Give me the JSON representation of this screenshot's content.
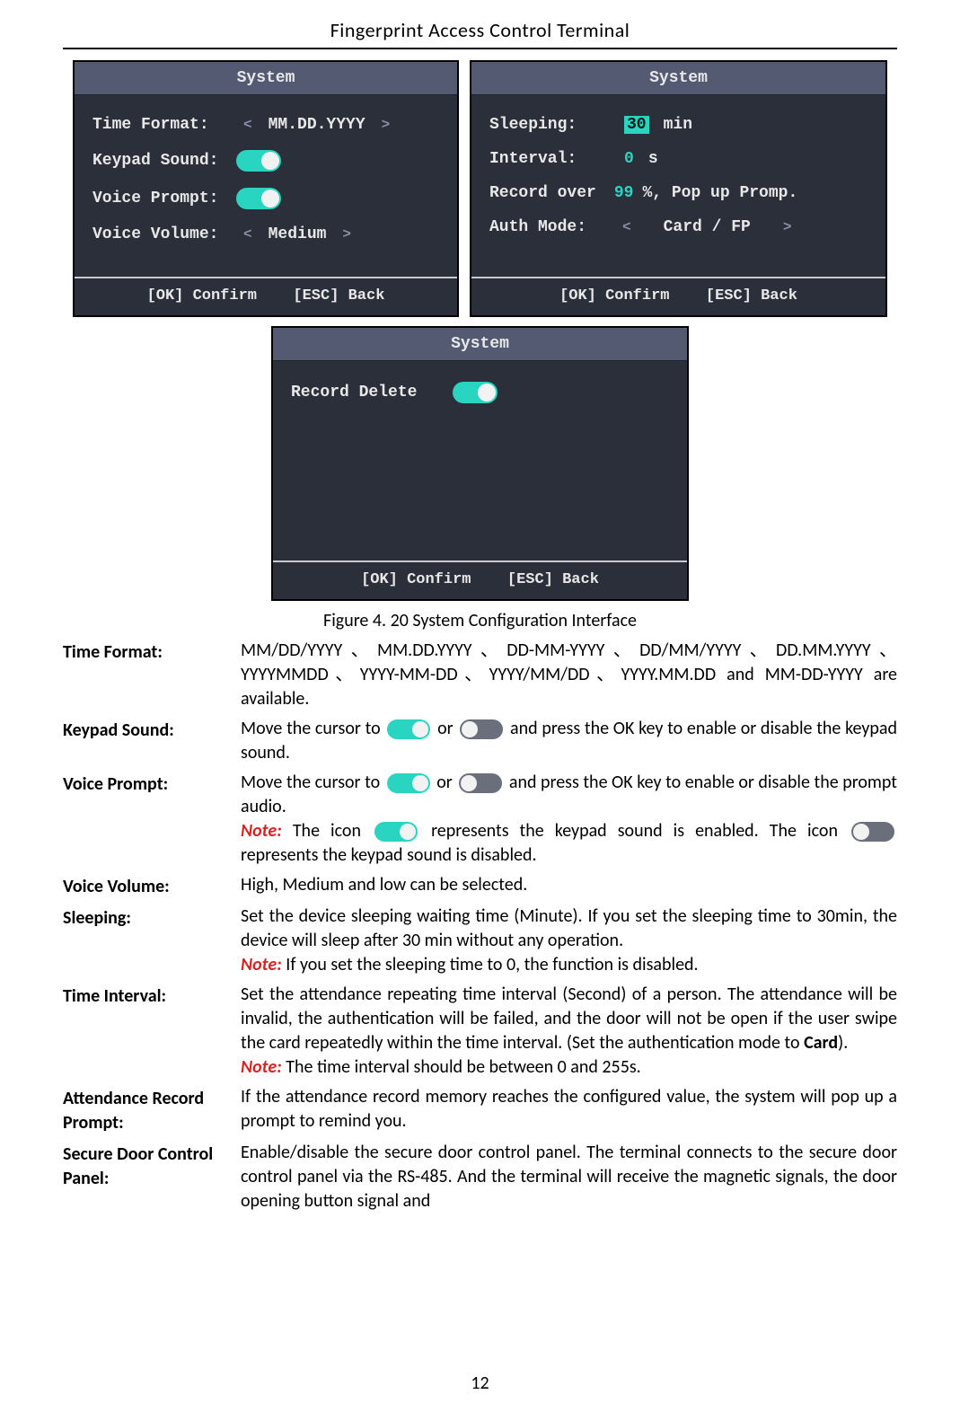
{
  "doc_title": "Fingerprint Access Control Terminal",
  "page_number": "12",
  "figure_caption": "Figure 4. 20  System Configuration Interface",
  "screens": {
    "title": "System",
    "footer_ok": "[OK] Confirm",
    "footer_esc": "[ESC] Back",
    "left": {
      "time_format_label": "Time Format:",
      "time_format_value": "MM.DD.YYYY",
      "keypad_sound_label": "Keypad Sound:",
      "voice_prompt_label": "Voice Prompt:",
      "voice_volume_label": "Voice Volume:",
      "voice_volume_value": "Medium"
    },
    "right": {
      "sleeping_label": "Sleeping:",
      "sleeping_value": "30",
      "sleeping_unit": "min",
      "interval_label": "Interval:",
      "interval_value": "0",
      "interval_unit": "s",
      "record_over_label": "Record over",
      "record_over_value": "99",
      "record_over_tail": "%, Pop up Promp.",
      "auth_mode_label": "Auth Mode:",
      "auth_mode_value": "Card / FP"
    },
    "bottom": {
      "record_delete_label": "Record Delete"
    }
  },
  "defs": {
    "time_format": {
      "label": "Time Format:",
      "body": "MM/DD/YYYY、MM.DD.YYYY、DD-MM-YYYY、DD/MM/YYYY、DD.MM.YYYY、YYYYMMDD、YYYY-MM-DD、YYYY/MM/DD、YYYY.MM.DD and MM-DD-YYYY are available."
    },
    "keypad_sound": {
      "label": "Keypad Sound:",
      "p1a": "Move the cursor to ",
      "p1b": " or ",
      "p1c": " and press the OK key to enable or disable the keypad sound."
    },
    "voice_prompt": {
      "label": "Voice Prompt:",
      "p1a": "Move the cursor to ",
      "p1b": " or ",
      "p1c": " and press the OK key to enable or disable the prompt audio.",
      "note_prefix": "Note: ",
      "p2a": "The icon ",
      "p2b": " represents the keypad sound is enabled. The icon ",
      "p2c": " represents the keypad sound is disabled."
    },
    "voice_volume": {
      "label": "Voice Volume:",
      "body": "High, Medium and low can be selected."
    },
    "sleeping": {
      "label": "Sleeping:",
      "body": "Set the device sleeping waiting time (Minute). If you set the sleeping time to 30min, the device will sleep after 30 min without any operation.",
      "note_prefix": "Note: ",
      "note_body": "If you set the sleeping time to 0, the function is disabled."
    },
    "time_interval": {
      "label": "Time Interval:",
      "p1": "Set the attendance repeating time interval (Second) of a person. The attendance will be invalid, the authentication will be failed, and the door will not be open if the user swipe the card repeatedly within the time interval. (Set the authentication mode to ",
      "card": "Card",
      "p1_tail": ").",
      "note_prefix": "Note: ",
      "note_body": "The time interval should be between 0 and 255s."
    },
    "attendance_prompt": {
      "label": "Attendance Record Prompt:",
      "body": "If the attendance record memory reaches the configured value, the system will pop up a prompt to remind you."
    },
    "secure_door": {
      "label": "Secure Door Control Panel:",
      "body": "Enable/disable the secure door control panel. The terminal connects to the secure door control panel via the RS-485. And the terminal will receive the magnetic signals, the door opening button signal and"
    }
  }
}
